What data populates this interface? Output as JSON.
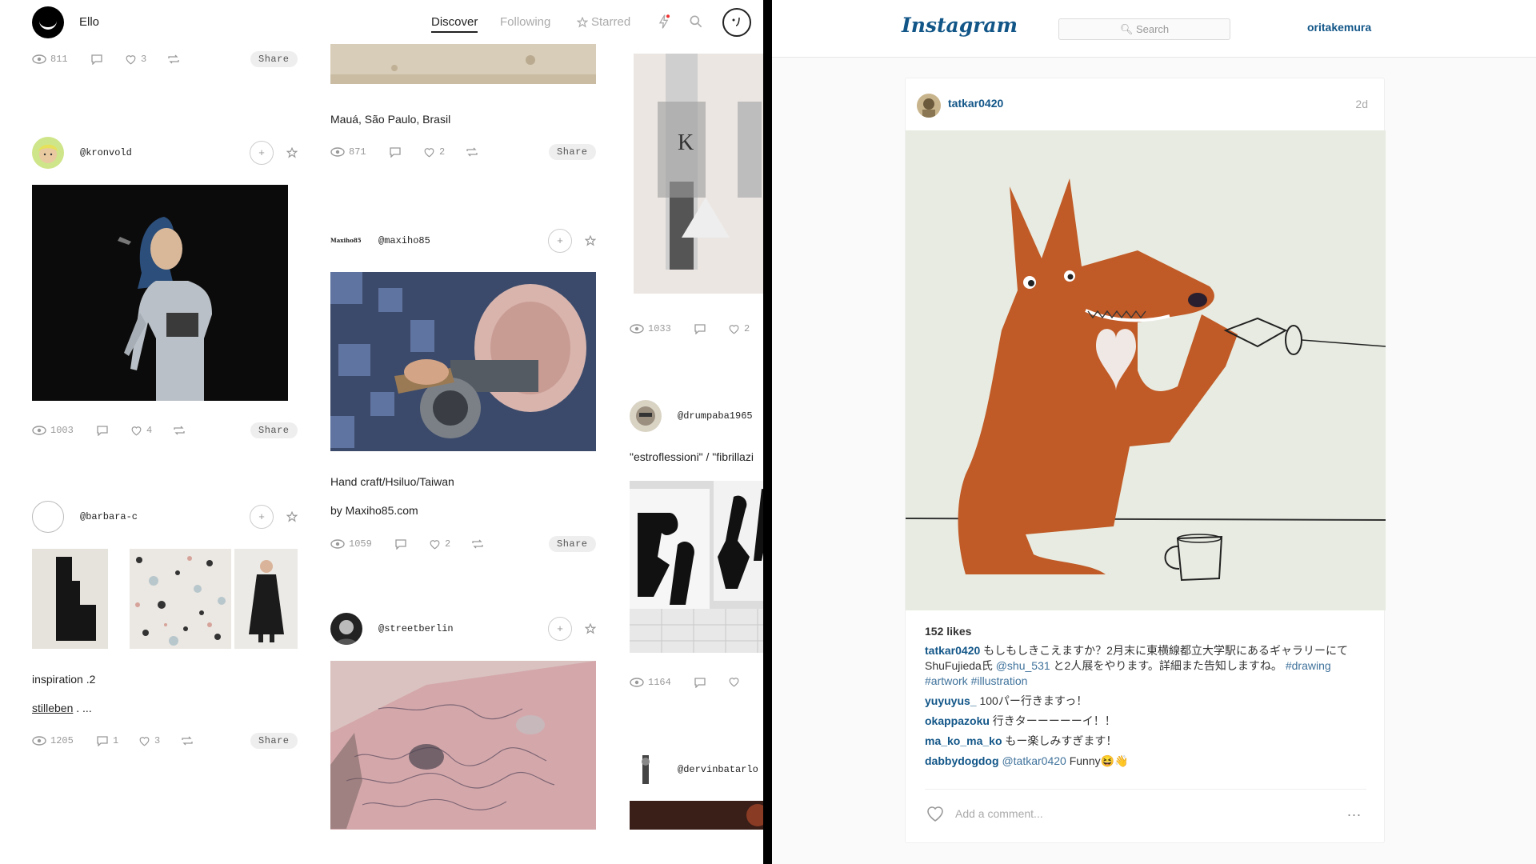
{
  "ello": {
    "brand": "Ello",
    "nav": {
      "discover": "Discover",
      "following": "Following",
      "starred": "Starred"
    },
    "share_label": "Share",
    "col1": {
      "post1": {
        "views": "811",
        "loves": "3"
      },
      "post2": {
        "user": "@kronvold",
        "views": "1003",
        "loves": "4"
      },
      "post3": {
        "user": "@barbara-c",
        "caption": "inspiration .2",
        "link": "stilleben",
        "link_suffix": " . ...",
        "views": "1205",
        "comments": "1",
        "loves": "3"
      }
    },
    "col2": {
      "post1": {
        "caption": "Mauá, São Paulo, Brasil",
        "views": "871",
        "loves": "2"
      },
      "post2": {
        "user": "@maxiho85",
        "logo_text": "Maxiho85",
        "caption1": "Hand craft/Hsiluo/Taiwan",
        "caption2": "by Maxiho85.com",
        "views": "1059",
        "loves": "2"
      },
      "post3": {
        "user": "@streetberlin"
      }
    },
    "col3": {
      "post1": {
        "views": "1033",
        "loves": "2"
      },
      "post2": {
        "user": "@drumpaba1965",
        "caption": "\"estroflessioni\" / \"fibrillazi",
        "views": "1164"
      },
      "post3": {
        "user": "@dervinbatarlo"
      }
    }
  },
  "instagram": {
    "logo": "Instagram",
    "search_placeholder": "Search",
    "current_user": "oritakemura",
    "post": {
      "user": "tatkar0420",
      "time": "2d",
      "likes": "152 likes",
      "caption": {
        "user": "tatkar0420",
        "text1": "もしもしきこえますか？2月末に東横線都立大学駅にあるギャラリーにて",
        "text2": "ShuFujieda氏 ",
        "mention": "@shu_531",
        "text3": " と2人展をやります。詳細また告知しますね。 ",
        "tag1": "#drawing",
        "tag2": "#artwork",
        "tag3": "#illustration"
      },
      "comments": [
        {
          "user": "yuyuyus_",
          "text": "100パー行きますっ！"
        },
        {
          "user": "okappazoku",
          "text": "行きターーーーーイ！！"
        },
        {
          "user": "ma_ko_ma_ko",
          "text": "もー楽しみすぎます！"
        },
        {
          "user": "dabbydogdog",
          "mention": "@tatkar0420",
          "text": " Funny😆👋"
        }
      ],
      "add_comment_placeholder": "Add a comment...",
      "more": "..."
    }
  }
}
